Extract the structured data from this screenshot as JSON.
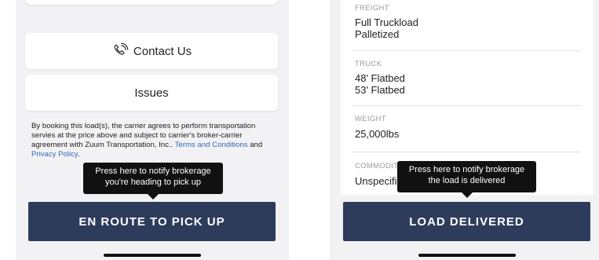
{
  "left_screen": {
    "contact_label": "Contact Us",
    "issues_label": "Issues",
    "terms_prefix": "By booking this load(s), the carrier agrees to perform transportation servies at the price above and subject to carrier's broker-carrier agreement with Zuum Transportation, Inc..",
    "terms_link": "Terms and Conditions",
    "and_text": "and",
    "privacy_link": "Privacy Policy",
    "period": ".",
    "tooltip": "Press here to notify brokerage you're heading to pick up",
    "button": "EN ROUTE TO PICK UP"
  },
  "right_screen": {
    "freight": {
      "label": "FREIGHT",
      "line1": "Full Truckload",
      "line2": "Palletized"
    },
    "truck": {
      "label": "TRUCK",
      "line1": "48' Flatbed",
      "line2": "53' Flatbed"
    },
    "weight": {
      "label": "WEIGHT",
      "value": "25,000lbs"
    },
    "commodity": {
      "label": "COMMODITY",
      "value": "Unspecified"
    },
    "tooltip": "Press here to notify brokerage the load is delivered",
    "button": "LOAD DELIVERED"
  },
  "colors": {
    "button_bg": "#2e3c5c",
    "link": "#3569b8",
    "tooltip_bg": "#111111"
  }
}
